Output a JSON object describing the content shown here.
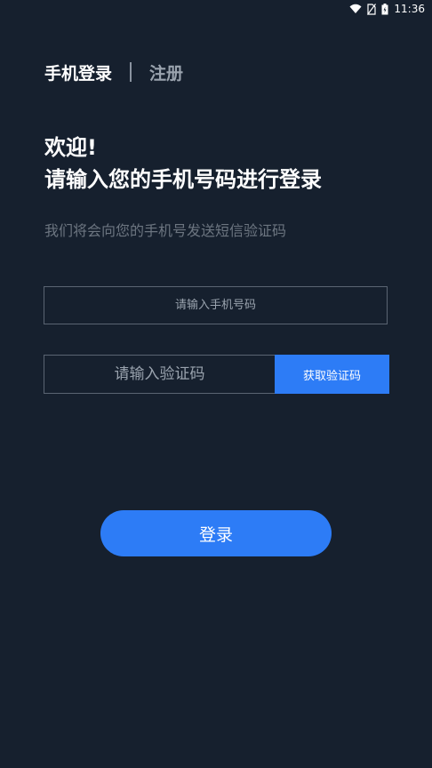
{
  "status_bar": {
    "time": "11:36",
    "icons": [
      "wifi-icon",
      "no-sim-icon",
      "battery-icon"
    ]
  },
  "tabs": {
    "active": "手机登录",
    "inactive": "注册"
  },
  "welcome": {
    "line1": "欢迎!",
    "line2": "请输入您的手机号码进行登录"
  },
  "subtitle": "我们将会向您的手机号发送短信验证码",
  "phone_input": {
    "placeholder": "请输入手机号码",
    "value": ""
  },
  "code_input": {
    "placeholder": "请输入验证码",
    "value": ""
  },
  "get_code_button": "获取验证码",
  "login_button": "登录",
  "colors": {
    "background": "#16202e",
    "accent": "#2d7cf6"
  }
}
